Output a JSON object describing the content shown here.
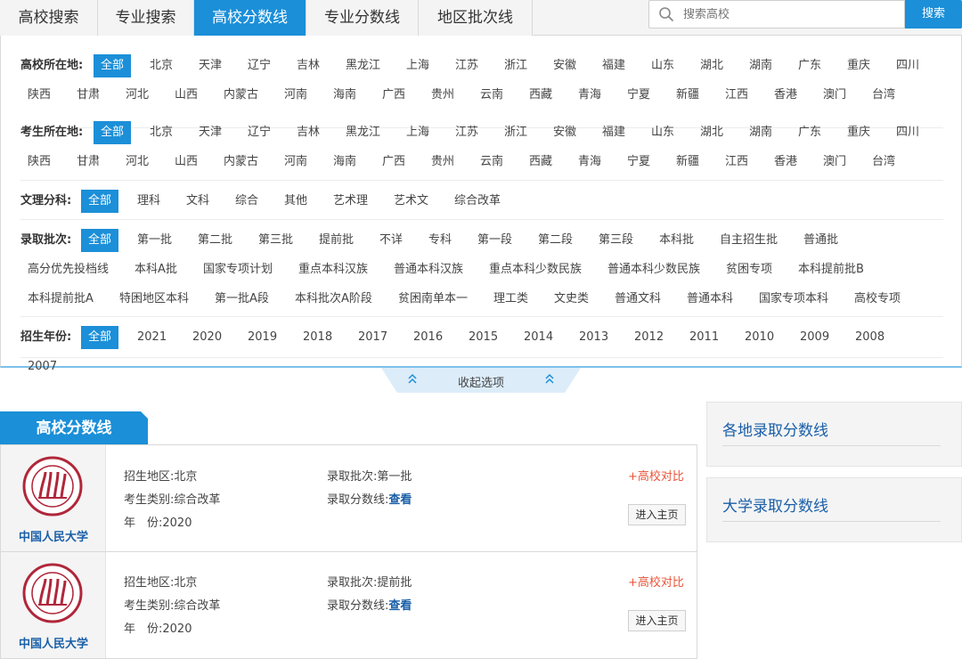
{
  "tabs": [
    "高校搜索",
    "专业搜索",
    "高校分数线",
    "专业分数线",
    "地区批次线"
  ],
  "active_tab": "高校分数线",
  "search": {
    "placeholder": "搜索高校",
    "button": "搜索",
    "icon": "search-icon"
  },
  "filters": {
    "school_location": {
      "label": "高校所在地:",
      "options": [
        "全部",
        "北京",
        "天津",
        "辽宁",
        "吉林",
        "黑龙江",
        "上海",
        "江苏",
        "浙江",
        "安徽",
        "福建",
        "山东",
        "湖北",
        "湖南",
        "广东",
        "重庆",
        "四川",
        "陕西",
        "甘肃",
        "河北",
        "山西",
        "内蒙古",
        "河南",
        "海南",
        "广西",
        "贵州",
        "云南",
        "西藏",
        "青海",
        "宁夏",
        "新疆",
        "江西",
        "香港",
        "澳门",
        "台湾"
      ],
      "selected": "全部"
    },
    "student_location": {
      "label": "考生所在地:",
      "options": [
        "全部",
        "北京",
        "天津",
        "辽宁",
        "吉林",
        "黑龙江",
        "上海",
        "江苏",
        "浙江",
        "安徽",
        "福建",
        "山东",
        "湖北",
        "湖南",
        "广东",
        "重庆",
        "四川",
        "陕西",
        "甘肃",
        "河北",
        "山西",
        "内蒙古",
        "河南",
        "海南",
        "广西",
        "贵州",
        "云南",
        "西藏",
        "青海",
        "宁夏",
        "新疆",
        "江西",
        "香港",
        "澳门",
        "台湾"
      ],
      "selected": "全部"
    },
    "subject": {
      "label": "文理分科:",
      "options": [
        "全部",
        "理科",
        "文科",
        "综合",
        "其他",
        "艺术理",
        "艺术文",
        "综合改革"
      ],
      "selected": "全部"
    },
    "batch": {
      "label": "录取批次:",
      "options": [
        "全部",
        "第一批",
        "第二批",
        "第三批",
        "提前批",
        "不详",
        "专科",
        "第一段",
        "第二段",
        "第三段",
        "本科批",
        "自主招生批",
        "普通批",
        "高分优先投档线",
        "本科A批",
        "国家专项计划",
        "重点本科汉族",
        "普通本科汉族",
        "重点本科少数民族",
        "普通本科少数民族",
        "贫困专项",
        "本科提前批B",
        "本科提前批A",
        "特困地区本科",
        "第一批A段",
        "本科批次A阶段",
        "贫困南单本一",
        "理工类",
        "文史类",
        "普通文科",
        "普通本科",
        "国家专项本科",
        "高校专项"
      ],
      "selected": "全部"
    },
    "year": {
      "label": "招生年份:",
      "options": [
        "全部",
        "2021",
        "2020",
        "2019",
        "2018",
        "2017",
        "2016",
        "2015",
        "2014",
        "2013",
        "2012",
        "2011",
        "2010",
        "2009",
        "2008",
        "2007"
      ],
      "selected": "全部"
    }
  },
  "collapse_label": "收起选项",
  "results": {
    "tab_label": "高校分数线",
    "cards": [
      {
        "university": "中国人民大学",
        "region_key": "招生地区:",
        "region": "北京",
        "category_key": "考生类别:",
        "category": "综合改革",
        "year_key": "年　份:",
        "year": "2020",
        "batch_key": "录取批次:",
        "batch": "第一批",
        "score_key": "录取分数线:",
        "score_link": "查看",
        "compare": "+高校对比",
        "home_btn": "进入主页"
      },
      {
        "university": "中国人民大学",
        "region_key": "招生地区:",
        "region": "北京",
        "category_key": "考生类别:",
        "category": "综合改革",
        "year_key": "年　份:",
        "year": "2020",
        "batch_key": "录取批次:",
        "batch": "提前批",
        "score_key": "录取分数线:",
        "score_link": "查看",
        "compare": "+高校对比",
        "home_btn": "进入主页"
      }
    ]
  },
  "sidebar": [
    "各地录取分数线",
    "大学录取分数线"
  ],
  "colors": {
    "accent": "#1b8fd8",
    "link": "#1a5fa8",
    "compare": "#e8553a",
    "logo": "#b0273a"
  }
}
